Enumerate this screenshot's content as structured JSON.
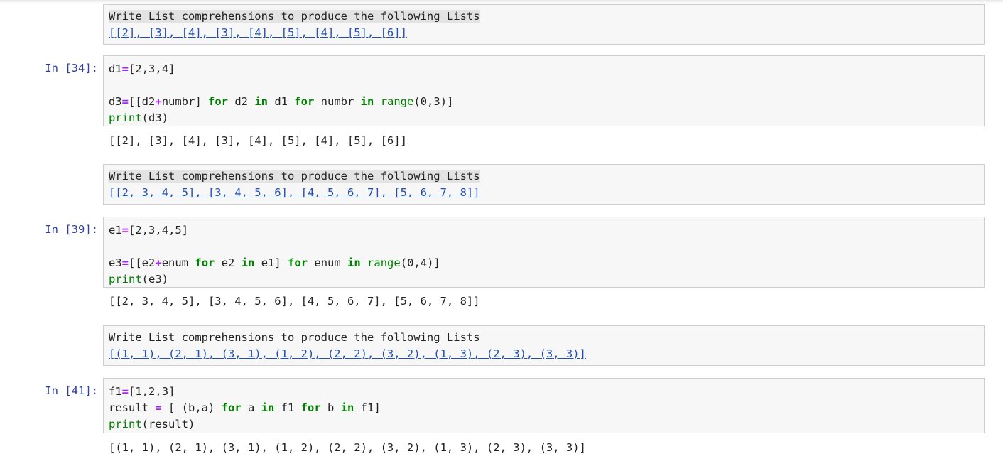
{
  "cells": [
    {
      "type": "markdown",
      "heading": "Write List comprehensions to produce the following Lists",
      "target": "[[2], [3], [4], [3], [4], [5], [4], [5], [6]]"
    },
    {
      "type": "code",
      "prompt": "In [34]:",
      "lines": [
        "d1=[2,3,4]",
        "",
        "d3=[[d2+numbr] for d2 in d1 for numbr in range(0,3)]",
        "print(d3)"
      ],
      "output": "[[2], [3], [4], [3], [4], [5], [4], [5], [6]]"
    },
    {
      "type": "markdown",
      "heading": "Write List comprehensions to produce the following Lists",
      "target": "[[2, 3, 4, 5], [3, 4, 5, 6], [4, 5, 6, 7], [5, 6, 7, 8]]"
    },
    {
      "type": "code",
      "prompt": "In [39]:",
      "lines": [
        "e1=[2,3,4,5]",
        "",
        "e3=[[e2+enum for e2 in e1] for enum in range(0,4)]",
        "print(e3)"
      ],
      "output": "[[2, 3, 4, 5], [3, 4, 5, 6], [4, 5, 6, 7], [5, 6, 7, 8]]"
    },
    {
      "type": "markdown",
      "heading": "Write List comprehensions to produce the following Lists",
      "target": "[(1, 1), (2, 1), (3, 1), (1, 2), (2, 2), (3, 2), (1, 3), (2, 3), (3, 3)]"
    },
    {
      "type": "code",
      "prompt": "In [41]:",
      "lines": [
        "f1=[1,2,3]",
        "result = [ (b,a) for a in f1 for b in f1]",
        "print(result)"
      ],
      "output": "[(1, 1), (2, 1), (3, 1), (1, 2), (2, 2), (3, 2), (1, 3), (2, 3), (3, 3)]"
    }
  ],
  "colors": {
    "prompt": "#303f9f",
    "keyword": "#008000",
    "operator": "#aa22ff",
    "link": "#1f4fb4",
    "cell_bg": "#f7f7f7",
    "cell_border": "#cfcfcf"
  }
}
